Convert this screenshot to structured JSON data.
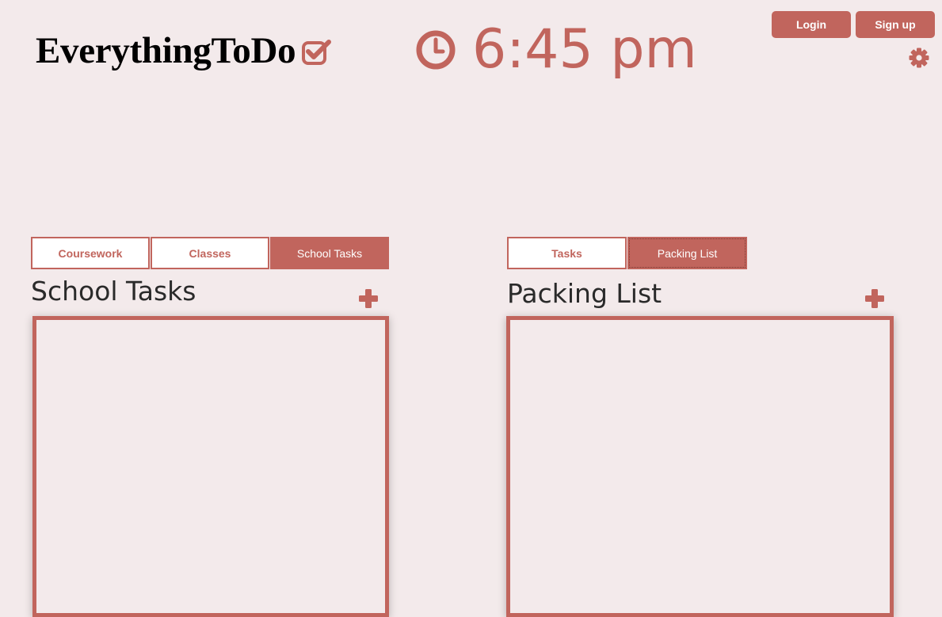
{
  "brand": {
    "name": "EverythingToDo",
    "check_icon": "check-square-icon"
  },
  "clock": {
    "icon": "clock-icon",
    "time": "6:45 pm"
  },
  "auth": {
    "login_label": "Login",
    "signup_label": "Sign up"
  },
  "settings": {
    "icon": "gear-icon"
  },
  "left_panel": {
    "tabs": [
      {
        "label": "Coursework",
        "active": false
      },
      {
        "label": "Classes",
        "active": false
      },
      {
        "label": "School Tasks",
        "active": true
      }
    ],
    "title": "School Tasks",
    "add_icon": "plus-icon",
    "items": []
  },
  "right_panel": {
    "tabs": [
      {
        "label": "Tasks",
        "active": false
      },
      {
        "label": "Packing List",
        "active": true
      }
    ],
    "title": "Packing List",
    "add_icon": "plus-icon",
    "items": []
  },
  "colors": {
    "accent": "#c1655d",
    "background": "#f3eaeb",
    "text": "#2a2a2a"
  }
}
